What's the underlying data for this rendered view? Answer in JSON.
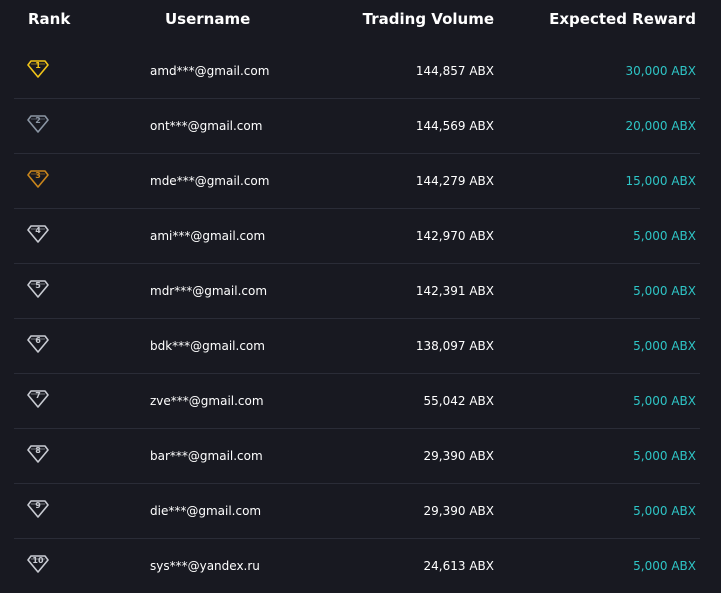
{
  "header": {
    "rank": "Rank",
    "username": "Username",
    "trading_volume": "Trading Volume",
    "expected_reward": "Expected Reward"
  },
  "rows": [
    {
      "rank": "1",
      "username": "amd***@gmail.com",
      "volume": "144,857 ABX",
      "reward": "30,000 ABX",
      "badge_icon": "gold-diamond-badge-icon",
      "badge_color": "#f0c419"
    },
    {
      "rank": "2",
      "username": "ont***@gmail.com",
      "volume": "144,569 ABX",
      "reward": "20,000 ABX",
      "badge_icon": "silver-diamond-badge-icon",
      "badge_color": "#8a95a3"
    },
    {
      "rank": "3",
      "username": "mde***@gmail.com",
      "volume": "144,279 ABX",
      "reward": "15,000 ABX",
      "badge_icon": "bronze-diamond-badge-icon",
      "badge_color": "#c9861c"
    },
    {
      "rank": "4",
      "username": "ami***@gmail.com",
      "volume": "142,970 ABX",
      "reward": "5,000 ABX",
      "badge_icon": "diamond-badge-icon",
      "badge_color": "#c8cbd2"
    },
    {
      "rank": "5",
      "username": "mdr***@gmail.com",
      "volume": "142,391 ABX",
      "reward": "5,000 ABX",
      "badge_icon": "diamond-badge-icon",
      "badge_color": "#c8cbd2"
    },
    {
      "rank": "6",
      "username": "bdk***@gmail.com",
      "volume": "138,097 ABX",
      "reward": "5,000 ABX",
      "badge_icon": "diamond-badge-icon",
      "badge_color": "#c8cbd2"
    },
    {
      "rank": "7",
      "username": "zve***@gmail.com",
      "volume": "55,042 ABX",
      "reward": "5,000 ABX",
      "badge_icon": "diamond-badge-icon",
      "badge_color": "#c8cbd2"
    },
    {
      "rank": "8",
      "username": "bar***@gmail.com",
      "volume": "29,390 ABX",
      "reward": "5,000 ABX",
      "badge_icon": "diamond-badge-icon",
      "badge_color": "#c8cbd2"
    },
    {
      "rank": "9",
      "username": "die***@gmail.com",
      "volume": "29,390 ABX",
      "reward": "5,000 ABX",
      "badge_icon": "diamond-badge-icon",
      "badge_color": "#c8cbd2"
    },
    {
      "rank": "10",
      "username": "sys***@yandex.ru",
      "volume": "24,613 ABX",
      "reward": "5,000 ABX",
      "badge_icon": "diamond-badge-icon",
      "badge_color": "#c8cbd2"
    }
  ],
  "colors": {
    "background": "#181921",
    "reward_accent": "#2ec5c6",
    "divider": "#2a2c37"
  }
}
